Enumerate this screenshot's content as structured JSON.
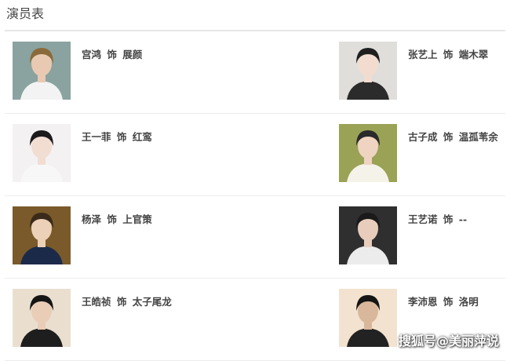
{
  "page": {
    "title": "演员表"
  },
  "cast": [
    {
      "actor": "宫鸿",
      "sep": "饰",
      "role": "展颜",
      "palette": {
        "bg": "#8aa3a0",
        "hair": "#8a6a3a",
        "skin": "#e9c9b1",
        "cloth": "#f3f3f3"
      }
    },
    {
      "actor": "张艺上",
      "sep": "饰",
      "role": "端木翠",
      "palette": {
        "bg": "#e0dedb",
        "hair": "#1f1f1f",
        "skin": "#f2dcd0",
        "cloth": "#2b2b2b"
      }
    },
    {
      "actor": "王一菲",
      "sep": "饰",
      "role": "红鸾",
      "palette": {
        "bg": "#f3f1f2",
        "hair": "#1c1a1a",
        "skin": "#f2ddd3",
        "cloth": "#f7f7f7"
      }
    },
    {
      "actor": "古子成",
      "sep": "饰",
      "role": "温孤苇余",
      "palette": {
        "bg": "#9aa256",
        "hair": "#2a2a2a",
        "skin": "#efd4c2",
        "cloth": "#f5f2ea"
      }
    },
    {
      "actor": "杨泽",
      "sep": "饰",
      "role": "上官策",
      "palette": {
        "bg": "#7a5a2a",
        "hair": "#3a2a1a",
        "skin": "#ecd0b8",
        "cloth": "#1c2a4a"
      }
    },
    {
      "actor": "王艺诺",
      "sep": "饰",
      "role": "--",
      "palette": {
        "bg": "#2f2f2f",
        "hair": "#1a1a1a",
        "skin": "#e8cdbd",
        "cloth": "#ececec"
      }
    },
    {
      "actor": "王皓祯",
      "sep": "饰",
      "role": "太子尾龙",
      "palette": {
        "bg": "#eadfcf",
        "hair": "#151515",
        "skin": "#e9cdb6",
        "cloth": "#1e1e1e"
      }
    },
    {
      "actor": "李沛恩",
      "sep": "饰",
      "role": "洛明",
      "palette": {
        "bg": "#f2e2cf",
        "hair": "#151515",
        "skin": "#d9b79a",
        "cloth": "#222222"
      }
    }
  ],
  "watermark": "搜狐号@美丽萍说"
}
